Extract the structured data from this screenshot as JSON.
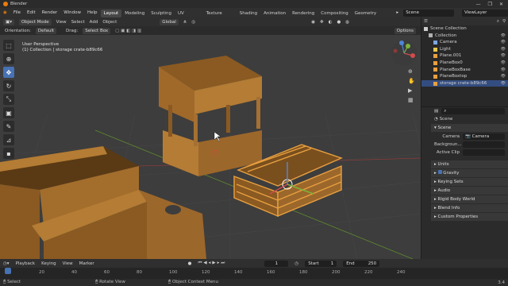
{
  "window": {
    "title": "Blender",
    "controls": [
      "—",
      "❐",
      "✕"
    ]
  },
  "menu": [
    "File",
    "Edit",
    "Render",
    "Window",
    "Help"
  ],
  "workspaces": [
    "Layout",
    "Modeling",
    "Sculpting",
    "UV Editing",
    "Texture Paint",
    "Shading",
    "Animation",
    "Rendering",
    "Compositing",
    "Geometry Nodes"
  ],
  "active_workspace": "Layout",
  "scene_name": "Scene",
  "view_layer": "ViewLayer",
  "header": {
    "mode": "Object Mode",
    "menus": [
      "View",
      "Select",
      "Add",
      "Object"
    ],
    "transform": "Global",
    "orientation_label": "Orientation:",
    "orientation": "Default",
    "drag_label": "Drag:",
    "drag": "Select Box",
    "options": "Options"
  },
  "viewport": {
    "perspective": "User Perspective",
    "collection": "(1) Collection | storage crate-b89c66"
  },
  "outliner": {
    "root": "Scene Collection",
    "items": [
      {
        "label": "Collection",
        "indent": 1,
        "color": "#b0b0b0"
      },
      {
        "label": "Camera",
        "indent": 2,
        "color": "#7ea6e0"
      },
      {
        "label": "Light",
        "indent": 2,
        "color": "#e6c84f"
      },
      {
        "label": "Plane.001",
        "indent": 2,
        "color": "#e8a040"
      },
      {
        "label": "PlaneBox0",
        "indent": 2,
        "color": "#e8a040"
      },
      {
        "label": "PlaneBoxBase",
        "indent": 2,
        "color": "#e8a040"
      },
      {
        "label": "PlaneBoxtop",
        "indent": 2,
        "color": "#e8a040"
      },
      {
        "label": "storage crate-b89c66",
        "indent": 2,
        "color": "#e8a040",
        "selected": true
      }
    ]
  },
  "properties": {
    "context": "Scene",
    "section": "Scene",
    "camera_label": "Camera",
    "camera_value": "Camera",
    "background_label": "Backgroun...",
    "active_clip_label": "Active Clip",
    "panels": [
      "Units",
      "Gravity",
      "Keying Sets",
      "Audio",
      "Rigid Body World",
      "Blend Info",
      "Custom Properties"
    ]
  },
  "timeline": {
    "menus": [
      "Playback",
      "Keying",
      "View",
      "Marker"
    ],
    "current_frame": "1",
    "start_label": "Start",
    "start": "1",
    "end_label": "End",
    "end": "250",
    "ticks": [
      "1",
      "20",
      "40",
      "60",
      "80",
      "100",
      "120",
      "140",
      "160",
      "180",
      "200",
      "220",
      "240"
    ]
  },
  "status": {
    "items": [
      "Select",
      "Rotate View",
      "Object Context Menu"
    ],
    "version": "3.4"
  },
  "colors": {
    "accent": "#4772b3",
    "selection": "#e8a040",
    "wood": "#9a6a2e"
  }
}
